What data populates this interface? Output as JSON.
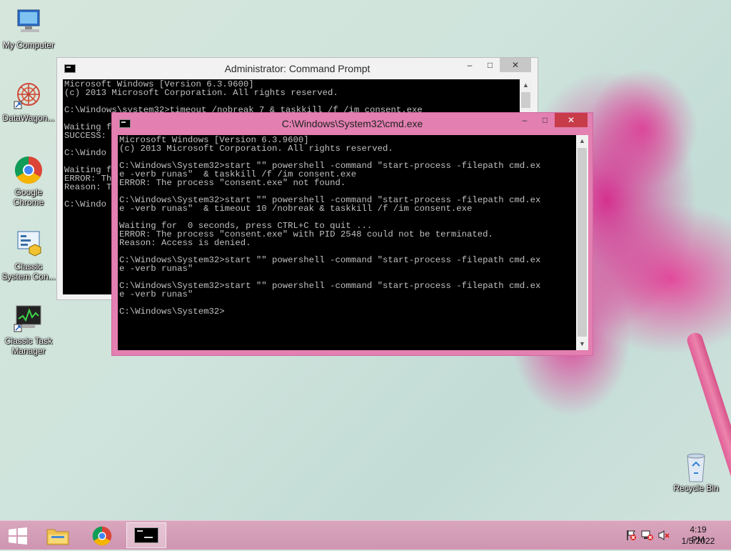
{
  "desktop": {
    "icons": [
      {
        "label": "My Computer",
        "icon": "computer-icon"
      },
      {
        "label": "DataWagon...",
        "icon": "datawagon-icon"
      },
      {
        "label": "Google Chrome",
        "icon": "chrome-icon"
      },
      {
        "label": "Classic System Con...",
        "icon": "control-panel-icon"
      },
      {
        "label": "Classic Task Manager",
        "icon": "task-manager-icon"
      },
      {
        "label": "Recycle Bin",
        "icon": "recycle-bin-icon"
      }
    ]
  },
  "window_back": {
    "title": "Administrator: Command Prompt",
    "minimize": "–",
    "maximize": "□",
    "close": "✕",
    "console": "Microsoft Windows [Version 6.3.9600]\n(c) 2013 Microsoft Corporation. All rights reserved.\n\nC:\\Windows\\system32>timeout /nobreak 7 & taskkill /f /im consent.exe\n\nWaiting f\nSUCCESS: \n\nC:\\Windo\n\nWaiting f\nERROR: Th\nReason: T\n\nC:\\Windo"
  },
  "window_front": {
    "title": "C:\\Windows\\System32\\cmd.exe",
    "minimize": "–",
    "maximize": "□",
    "close": "✕",
    "console": "Microsoft Windows [Version 6.3.9600]\n(c) 2013 Microsoft Corporation. All rights reserved.\n\nC:\\Windows\\System32>start \"\" powershell -command \"start-process -filepath cmd.ex\ne -verb runas\"  & taskkill /f /im consent.exe\nERROR: The process \"consent.exe\" not found.\n\nC:\\Windows\\System32>start \"\" powershell -command \"start-process -filepath cmd.ex\ne -verb runas\"  & timeout 10 /nobreak & taskkill /f /im consent.exe\n\nWaiting for  0 seconds, press CTRL+C to quit ...\nERROR: The process \"consent.exe\" with PID 2548 could not be terminated.\nReason: Access is denied.\n\nC:\\Windows\\System32>start \"\" powershell -command \"start-process -filepath cmd.ex\ne -verb runas\"\n\nC:\\Windows\\System32>start \"\" powershell -command \"start-process -filepath cmd.ex\ne -verb runas\"\n\nC:\\Windows\\System32>"
  },
  "taskbar": {
    "start_icon": "windows-logo-icon",
    "pinned": [
      {
        "name": "file-explorer",
        "icon": "folder-icon"
      },
      {
        "name": "chrome",
        "icon": "chrome-icon"
      },
      {
        "name": "command-prompt",
        "icon": "cmd-icon",
        "active": true
      }
    ],
    "tray_icons": [
      "flag-icon",
      "network-icon",
      "speaker-muted-icon"
    ],
    "time": "4:19 PM",
    "date": "1/5/2022"
  }
}
